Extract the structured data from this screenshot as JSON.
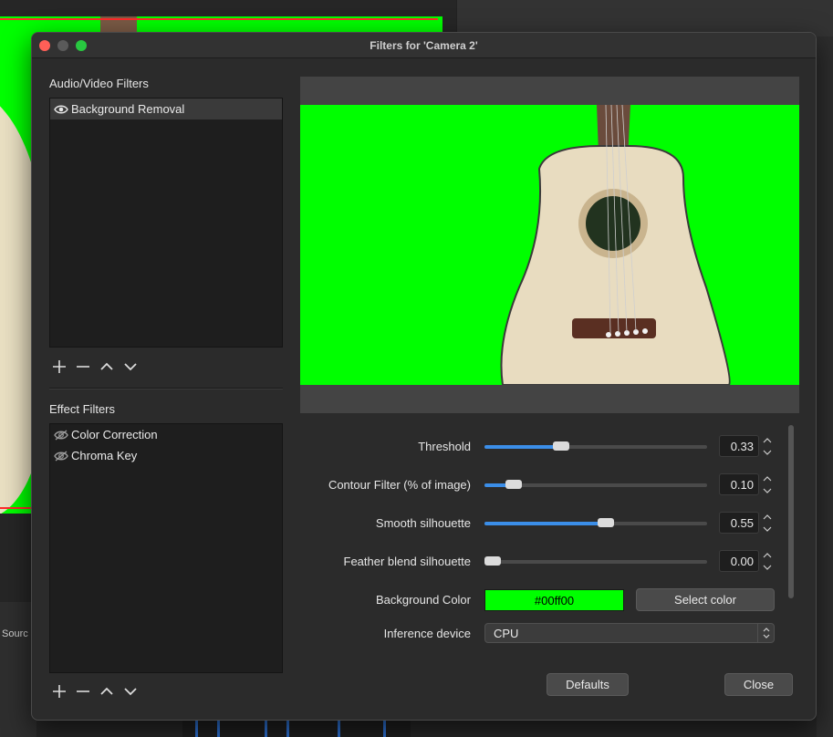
{
  "background": {
    "sources_label": "Sourc"
  },
  "window": {
    "title": "Filters for 'Camera 2'"
  },
  "audio_video_filters": {
    "label": "Audio/Video Filters",
    "items": [
      {
        "label": "Background Removal",
        "visible": true,
        "selected": true
      }
    ]
  },
  "effect_filters": {
    "label": "Effect Filters",
    "items": [
      {
        "label": "Color Correction",
        "visible": false
      },
      {
        "label": "Chroma Key",
        "visible": false
      }
    ]
  },
  "toolbar": {
    "add": "+",
    "remove": "−",
    "up": "⌃",
    "down": "⌄"
  },
  "properties": {
    "threshold": {
      "label": "Threshold",
      "value": "0.33",
      "fraction": 0.33
    },
    "contour": {
      "label": "Contour Filter (% of image)",
      "value": "0.10",
      "fraction": 0.1
    },
    "smooth": {
      "label": "Smooth silhouette",
      "value": "0.55",
      "fraction": 0.55
    },
    "feather": {
      "label": "Feather blend silhouette",
      "value": "0.00",
      "fraction": 0.0
    },
    "background_color": {
      "label": "Background Color",
      "value": "#00ff00",
      "display": "#00ff00",
      "button": "Select color"
    },
    "inference_device": {
      "label": "Inference device",
      "value": "CPU"
    }
  },
  "buttons": {
    "defaults": "Defaults",
    "close": "Close"
  },
  "colors": {
    "accent": "#3b8ee8",
    "chroma_green": "#00ff00"
  }
}
